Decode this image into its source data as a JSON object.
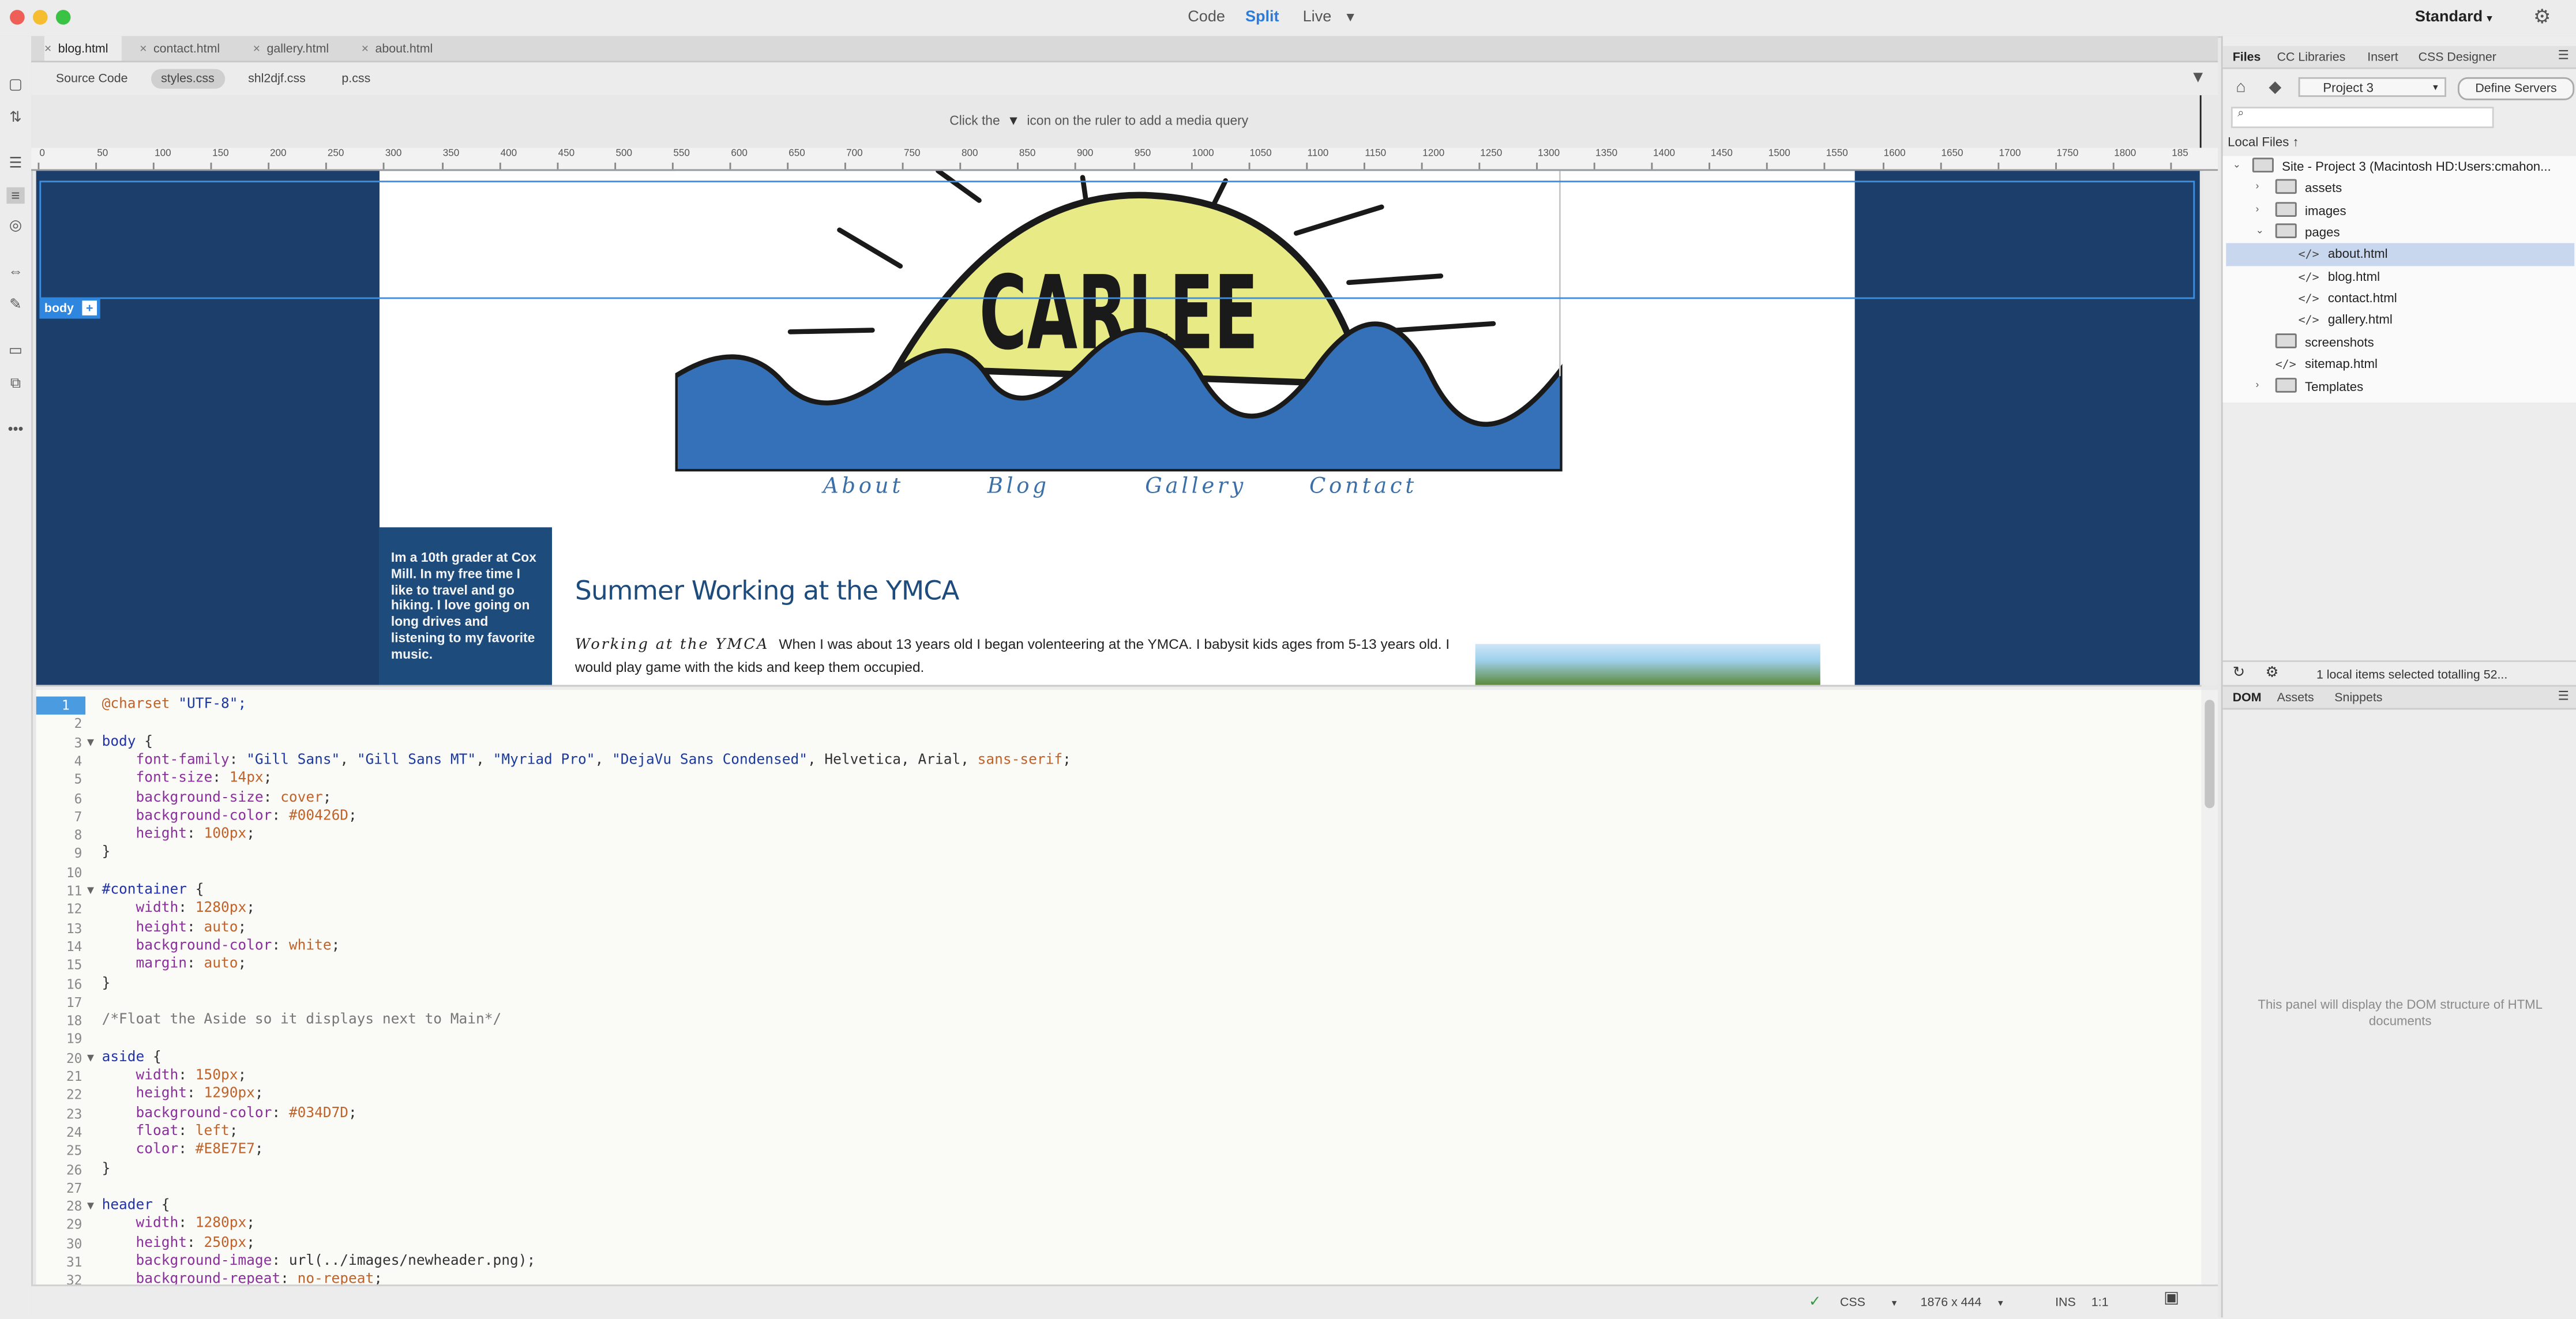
{
  "topbar": {
    "view_modes": [
      "Code",
      "Split",
      "Live"
    ],
    "active_mode": "Split",
    "workspace": "Standard"
  },
  "doc_tabs": [
    "blog.html",
    "contact.html",
    "gallery.html",
    "about.html"
  ],
  "related_files": [
    "Source Code",
    "styles.css",
    "shl2djf.css",
    "p.css"
  ],
  "media_query_hint": {
    "before": "Click the",
    "after": "icon on the ruler to add a media query"
  },
  "ruler_ticks": [
    "0",
    "50",
    "100",
    "150",
    "200",
    "250",
    "300",
    "350",
    "400",
    "450",
    "500",
    "550",
    "600",
    "650",
    "700",
    "750",
    "800",
    "850",
    "900",
    "950",
    "1000",
    "1050",
    "1100",
    "1150",
    "1200",
    "1250",
    "1300",
    "1350",
    "1400",
    "1450",
    "1500",
    "1550",
    "1600",
    "1650",
    "1700",
    "1750",
    "1800",
    "185"
  ],
  "design": {
    "body_tag": "body",
    "logo_text": "CARLEE",
    "nav": [
      "About",
      "Blog",
      "Gallery",
      "Contact"
    ],
    "aside_text": "Im a 10th grader at Cox Mill. In my free time I like to travel and go hiking. I love going on long drives and listening to my favorite music.",
    "post_title": "Summer Working at the YMCA",
    "post_script": "Working at the YMCA",
    "post_body": "When I was about 13 years old  I began volenteering at the YMCA. I babysit kids ages from 5-13 years old. I would play game with the kids and keep them occupied.",
    "colors": {
      "body_bg": "#1b3f6a",
      "aside_bg": "#1d4b7c",
      "wave": "#3571b8",
      "sun": "#e8ea86"
    }
  },
  "code_lines": [
    {
      "n": "1",
      "t": "@charset \"UTF-8\";"
    },
    {
      "n": "2",
      "t": ""
    },
    {
      "n": "3",
      "t": "body {"
    },
    {
      "n": "4",
      "t": "    font-family: \"Gill Sans\", \"Gill Sans MT\", \"Myriad Pro\", \"DejaVu Sans Condensed\", Helvetica, Arial, sans-serif;"
    },
    {
      "n": "5",
      "t": "    font-size: 14px;"
    },
    {
      "n": "6",
      "t": "    background-size: cover;"
    },
    {
      "n": "7",
      "t": "    background-color: #00426D;"
    },
    {
      "n": "8",
      "t": "    height: 100px;"
    },
    {
      "n": "9",
      "t": "}"
    },
    {
      "n": "10",
      "t": ""
    },
    {
      "n": "11",
      "t": "#container {"
    },
    {
      "n": "12",
      "t": "    width: 1280px;"
    },
    {
      "n": "13",
      "t": "    height: auto;"
    },
    {
      "n": "14",
      "t": "    background-color: white;"
    },
    {
      "n": "15",
      "t": "    margin: auto;"
    },
    {
      "n": "16",
      "t": "}"
    },
    {
      "n": "17",
      "t": ""
    },
    {
      "n": "18",
      "t": "/*Float the Aside so it displays next to Main*/"
    },
    {
      "n": "19",
      "t": ""
    },
    {
      "n": "20",
      "t": "aside {"
    },
    {
      "n": "21",
      "t": "    width: 150px;"
    },
    {
      "n": "22",
      "t": "    height: 1290px;"
    },
    {
      "n": "23",
      "t": "    background-color: #034D7D;"
    },
    {
      "n": "24",
      "t": "    float: left;"
    },
    {
      "n": "25",
      "t": "    color: #E8E7E7;"
    },
    {
      "n": "26",
      "t": "}"
    },
    {
      "n": "27",
      "t": ""
    },
    {
      "n": "28",
      "t": "header {"
    },
    {
      "n": "29",
      "t": "    width: 1280px;"
    },
    {
      "n": "30",
      "t": "    height: 250px;"
    },
    {
      "n": "31",
      "t": "    background-image: url(../images/newheader.png);"
    },
    {
      "n": "32",
      "t": "    background-repeat: no-repeat;"
    }
  ],
  "status": {
    "language": "CSS",
    "size": "1876 x 444",
    "mode": "INS",
    "position": "1:1"
  },
  "panel": {
    "tabs": [
      "Files",
      "CC Libraries",
      "Insert",
      "CSS Designer"
    ],
    "site_select": "Project 3",
    "define_servers": "Define Servers",
    "local_files": "Local Files",
    "tree": [
      {
        "label": "Site - Project 3 (Macintosh HD:Users:cmahon...",
        "type": "folder",
        "depth": 0,
        "open": true
      },
      {
        "label": "assets",
        "type": "folder",
        "depth": 1,
        "open": false
      },
      {
        "label": "images",
        "type": "folder",
        "depth": 1,
        "open": false
      },
      {
        "label": "pages",
        "type": "folder",
        "depth": 1,
        "open": true
      },
      {
        "label": "about.html",
        "type": "file",
        "depth": 2,
        "selected": true
      },
      {
        "label": "blog.html",
        "type": "file",
        "depth": 2
      },
      {
        "label": "contact.html",
        "type": "file",
        "depth": 2
      },
      {
        "label": "gallery.html",
        "type": "file",
        "depth": 2
      },
      {
        "label": "screenshots",
        "type": "folder",
        "depth": 1
      },
      {
        "label": "sitemap.html",
        "type": "file",
        "depth": 1
      },
      {
        "label": "Templates",
        "type": "folder",
        "depth": 1,
        "open": false
      }
    ],
    "status_text": "1 local items selected totalling 52...",
    "bottom_tabs": [
      "DOM",
      "Assets",
      "Snippets"
    ],
    "dom_placeholder": "This panel will display the DOM structure of HTML documents"
  }
}
